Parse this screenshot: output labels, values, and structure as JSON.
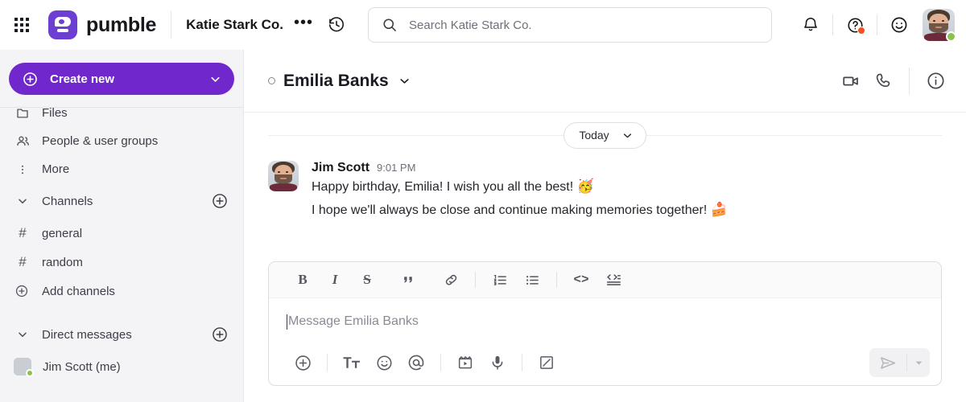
{
  "topbar": {
    "apps_grid_icon": "apps-grid-icon",
    "brand_name": "pumble",
    "logo_icon": "pumble-logo-icon",
    "workspace_name": "Katie Stark Co.",
    "workspace_more_label": "•••",
    "history_icon": "history-clock-icon",
    "search": {
      "placeholder": "Search Katie Stark Co.",
      "value": "",
      "icon": "search-icon"
    },
    "notifications_icon": "bell-icon",
    "help_icon": "help-question-icon",
    "help_badge": true,
    "status_icon": "smiley-face-icon",
    "avatar": "user-avatar",
    "presence_color": "#8bc34a"
  },
  "sidebar": {
    "create_new": {
      "label": "Create new",
      "plus_icon": "plus-circle-icon",
      "caret_icon": "chevron-down-icon",
      "color": "#7028cc"
    },
    "nav_items": [
      {
        "label": "Files",
        "icon": "files-icon"
      },
      {
        "label": "People & user groups",
        "icon": "people-icon"
      },
      {
        "label": "More",
        "icon": "more-vertical-icon"
      }
    ],
    "channels_section": {
      "title": "Channels",
      "caret_icon": "chevron-down-icon",
      "add_icon": "plus-circle-icon",
      "items": [
        {
          "label": "general",
          "prefix": "#"
        },
        {
          "label": "random",
          "prefix": "#"
        }
      ],
      "add_channels_label": "Add channels",
      "add_channels_icon": "plus-circle-icon"
    },
    "dm_section": {
      "title": "Direct messages",
      "caret_icon": "chevron-down-icon",
      "add_icon": "plus-circle-icon",
      "items": [
        {
          "label": "Jim Scott (me)",
          "avatar": "jim-scott-avatar",
          "presence": "online"
        }
      ]
    }
  },
  "conversation": {
    "header": {
      "name": "Emilia Banks",
      "status_icon": "presence-ring-icon",
      "caret_icon": "chevron-down-icon",
      "video_call_icon": "video-camera-icon",
      "voice_call_icon": "phone-icon",
      "info_icon": "info-circle-icon"
    },
    "day_divider": {
      "label": "Today",
      "caret_icon": "chevron-down-icon"
    },
    "messages": [
      {
        "author": "Jim Scott",
        "time": "9:01 PM",
        "avatar": "jim-scott-avatar",
        "lines": [
          {
            "text": "Happy birthday, Emilia! I wish you all the best! ",
            "emoji": "🥳"
          },
          {
            "text": "I hope we'll always be close and continue making memories together! ",
            "emoji": "🍰"
          }
        ]
      }
    ]
  },
  "composer": {
    "format_buttons": [
      {
        "name": "bold",
        "glyph": "B"
      },
      {
        "name": "italic",
        "glyph": "I"
      },
      {
        "name": "strikethrough",
        "glyph": "S"
      },
      {
        "name": "blockquote",
        "glyph": "❞"
      },
      {
        "name": "link",
        "glyph": "link-icon"
      },
      {
        "name": "ordered-list",
        "glyph": "ordered-list-icon"
      },
      {
        "name": "bulleted-list",
        "glyph": "bulleted-list-icon"
      },
      {
        "name": "inline-code",
        "glyph": "<>"
      },
      {
        "name": "code-block",
        "glyph": "code-block-icon"
      }
    ],
    "input": {
      "placeholder": "Message Emilia Banks",
      "value": ""
    },
    "action_buttons": [
      {
        "name": "attach",
        "icon": "plus-circle-icon"
      },
      {
        "name": "formatting",
        "icon": "text-format-icon",
        "glyph": "Tᴛ"
      },
      {
        "name": "emoji",
        "icon": "smiley-icon"
      },
      {
        "name": "mention",
        "icon": "at-icon"
      },
      {
        "name": "video-clip",
        "icon": "video-clip-icon"
      },
      {
        "name": "audio-clip",
        "icon": "microphone-icon"
      },
      {
        "name": "draw",
        "icon": "draw-slash-icon"
      }
    ],
    "send": {
      "icon": "send-paper-plane-icon",
      "caret_icon": "chevron-down-icon",
      "enabled": false
    }
  }
}
